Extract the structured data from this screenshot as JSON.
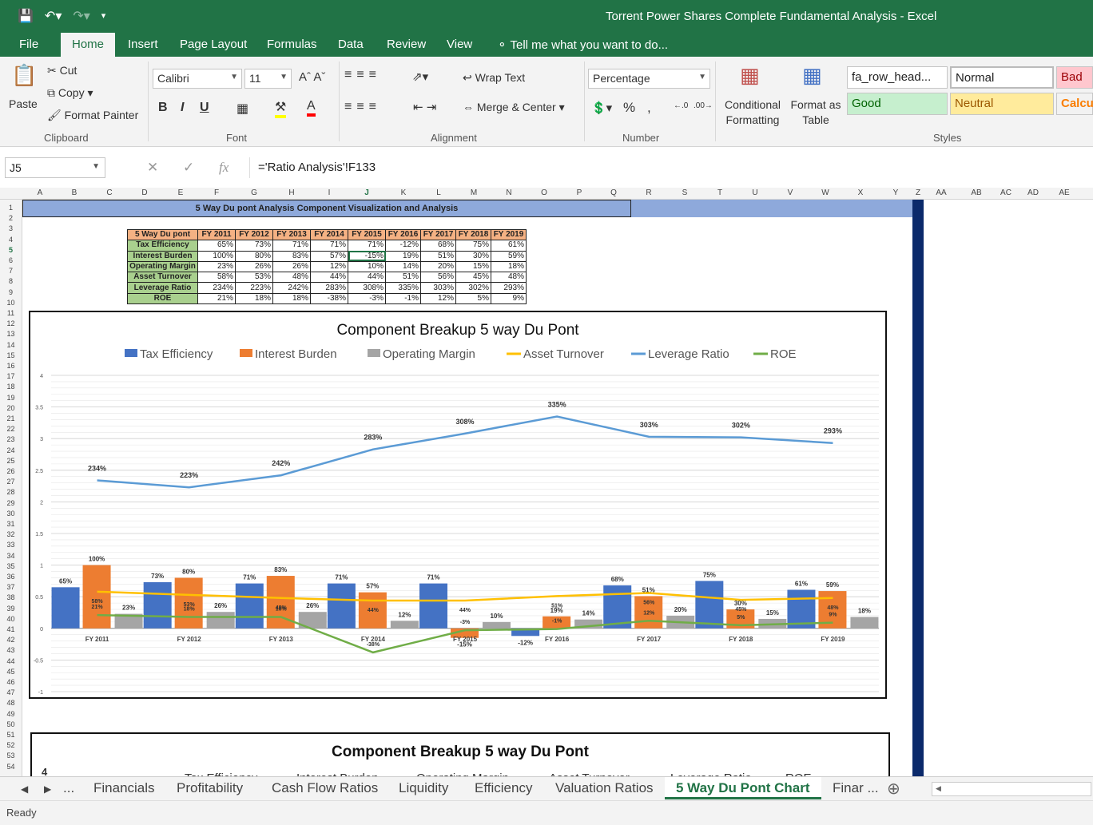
{
  "window": {
    "title": "Torrent Power Shares Complete Fundamental Analysis - Excel"
  },
  "menu": {
    "tabs": [
      "File",
      "Home",
      "Insert",
      "Page Layout",
      "Formulas",
      "Data",
      "Review",
      "View"
    ],
    "tell_me": "Tell me what you want to do..."
  },
  "ribbon": {
    "clipboard": {
      "paste": "Paste",
      "cut": "Cut",
      "copy": "Copy",
      "format_painter": "Format Painter",
      "label": "Clipboard"
    },
    "font": {
      "name": "Calibri",
      "size": "11",
      "label": "Font"
    },
    "alignment": {
      "wrap": "Wrap Text",
      "merge": "Merge & Center",
      "label": "Alignment"
    },
    "number": {
      "format": "Percentage",
      "label": "Number"
    },
    "styles": {
      "conditional": "Conditional Formatting",
      "format_table": "Format as Table",
      "cells": [
        "fa_row_head...",
        "Normal",
        "Bad",
        "Good",
        "Neutral",
        "Calcu"
      ],
      "label": "Styles"
    }
  },
  "formula_bar": {
    "cell": "J5",
    "formula": "='Ratio Analysis'!F133"
  },
  "columns": [
    "A",
    "B",
    "C",
    "D",
    "E",
    "F",
    "G",
    "H",
    "I",
    "J",
    "K",
    "L",
    "M",
    "N",
    "O",
    "P",
    "Q",
    "R",
    "S",
    "T",
    "U",
    "V",
    "W",
    "X",
    "Y",
    "Z",
    "AA",
    "AB",
    "AC",
    "AD",
    "AE"
  ],
  "banner": "5 Way Du pont Analysis Component Visualization and Analysis",
  "table": {
    "headers": [
      "5 Way Du pont",
      "FY 2011",
      "FY 2012",
      "FY 2013",
      "FY 2014",
      "FY 2015",
      "FY 2016",
      "FY 2017",
      "FY 2018",
      "FY 2019"
    ],
    "rows": [
      {
        "label": "Tax Efficiency",
        "values": [
          "65%",
          "73%",
          "71%",
          "71%",
          "71%",
          "-12%",
          "68%",
          "75%",
          "61%"
        ]
      },
      {
        "label": "Interest Burden",
        "values": [
          "100%",
          "80%",
          "83%",
          "57%",
          "-15%",
          "19%",
          "51%",
          "30%",
          "59%"
        ]
      },
      {
        "label": "Operating Margin",
        "values": [
          "23%",
          "26%",
          "26%",
          "12%",
          "10%",
          "14%",
          "20%",
          "15%",
          "18%"
        ]
      },
      {
        "label": "Asset Turnover",
        "values": [
          "58%",
          "53%",
          "48%",
          "44%",
          "44%",
          "51%",
          "56%",
          "45%",
          "48%"
        ]
      },
      {
        "label": "Leverage Ratio",
        "values": [
          "234%",
          "223%",
          "242%",
          "283%",
          "308%",
          "335%",
          "303%",
          "302%",
          "293%"
        ]
      },
      {
        "label": "ROE",
        "values": [
          "21%",
          "18%",
          "18%",
          "-38%",
          "-3%",
          "-1%",
          "12%",
          "5%",
          "9%"
        ]
      }
    ]
  },
  "chart_data": [
    {
      "type": "bar",
      "title": "Component Breakup 5 way Du Pont",
      "categories": [
        "FY 2011",
        "FY 2012",
        "FY 2013",
        "FY 2014",
        "FY 2015",
        "FY 2016",
        "FY 2017",
        "FY 2018",
        "FY 2019"
      ],
      "ylim": [
        -1,
        4
      ],
      "yticks": [
        -1,
        -0.5,
        0,
        0.5,
        1,
        1.5,
        2,
        2.5,
        3,
        3.5,
        4
      ],
      "grid": true,
      "legend": "top",
      "series": [
        {
          "name": "Tax Efficiency",
          "kind": "bar",
          "color": "#4472c4",
          "values": [
            0.65,
            0.73,
            0.71,
            0.71,
            0.71,
            -0.12,
            0.68,
            0.75,
            0.61
          ],
          "labels": [
            "65%",
            "73%",
            "71%",
            "71%",
            "71%",
            "-12%",
            "68%",
            "75%",
            "61%"
          ]
        },
        {
          "name": "Interest Burden",
          "kind": "bar",
          "color": "#ed7d31",
          "values": [
            1.0,
            0.8,
            0.83,
            0.57,
            -0.15,
            0.19,
            0.51,
            0.3,
            0.59
          ],
          "labels": [
            "100%",
            "80%",
            "83%",
            "57%",
            "-15%",
            "19%",
            "51%",
            "30%",
            "59%"
          ]
        },
        {
          "name": "Operating Margin",
          "kind": "bar",
          "color": "#a5a5a5",
          "values": [
            0.23,
            0.26,
            0.26,
            0.12,
            0.1,
            0.14,
            0.2,
            0.15,
            0.18
          ],
          "labels": [
            "23%",
            "26%",
            "26%",
            "12%",
            "10%",
            "14%",
            "20%",
            "15%",
            "18%"
          ]
        },
        {
          "name": "Asset Turnover",
          "kind": "line",
          "color": "#ffc000",
          "values": [
            0.58,
            0.53,
            0.48,
            0.44,
            0.44,
            0.51,
            0.56,
            0.45,
            0.48
          ],
          "labels": [
            "58%",
            "53%",
            "48%",
            "44%",
            "44%",
            "51%",
            "56%",
            "45%",
            "48%"
          ]
        },
        {
          "name": "Leverage Ratio",
          "kind": "line",
          "color": "#5b9bd5",
          "values": [
            2.34,
            2.23,
            2.42,
            2.83,
            3.08,
            3.35,
            3.03,
            3.02,
            2.93
          ],
          "labels": [
            "234%",
            "223%",
            "242%",
            "283%",
            "308%",
            "335%",
            "303%",
            "302%",
            "293%"
          ]
        },
        {
          "name": "ROE",
          "kind": "line",
          "color": "#70ad47",
          "values": [
            0.21,
            0.18,
            0.18,
            -0.38,
            -0.03,
            -0.01,
            0.12,
            0.05,
            0.09
          ],
          "labels": [
            "21%",
            "18%",
            "18%",
            "-38%",
            "-3%",
            "-1%",
            "12%",
            "5%",
            "9%"
          ]
        }
      ]
    },
    {
      "type": "bar",
      "title": "Component Breakup 5 way Du Pont",
      "yticks": [
        4
      ],
      "legend": "top",
      "series": [
        {
          "name": "Tax Efficiency",
          "color": "#4472c4"
        },
        {
          "name": "Interest Burden",
          "color": "#ed7d31"
        },
        {
          "name": "Operating Margin",
          "color": "#a5a5a5"
        },
        {
          "name": "Asset Turnover",
          "color": "#ffc000"
        },
        {
          "name": "Leverage Ratio",
          "color": "#5b9bd5"
        },
        {
          "name": "ROE",
          "color": "#70ad47"
        }
      ]
    }
  ],
  "sheet_tabs": [
    "...",
    "Financials",
    "Profitability",
    "Cash Flow Ratios",
    "Liquidity",
    "Efficiency",
    "Valuation Ratios",
    "5 Way Du Pont Chart",
    "Finar ..."
  ],
  "active_sheet": "5 Way Du Pont Chart",
  "status": "Ready"
}
